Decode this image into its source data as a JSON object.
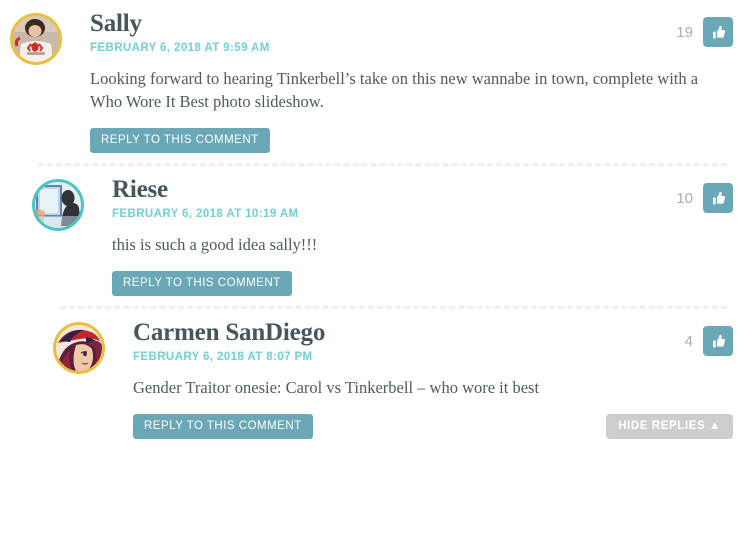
{
  "page": {
    "title": "Comment Thread",
    "accent_teal": "#6aa8b7",
    "date_teal": "#6fcfd6",
    "name_color": "#46565c",
    "body_color": "#4e5b61",
    "gray_button": "#cdcdcd",
    "separator_color": "#eeeff0"
  },
  "comments": [
    {
      "id": "comment-sally",
      "author": "Sally",
      "date": "FEBRUARY 6, 2018 AT 9:59 AM",
      "body": "Looking forward to hearing Tinkerbell’s take on this new wannabe in town, complete with a Who Wore It Best photo slideshow.",
      "vote_count": "19",
      "reply_label": "REPLY TO THIS COMMENT",
      "avatar_ring_color": "#ebbf3b",
      "avatar_alt": "sally-avatar",
      "depth": 0
    },
    {
      "id": "comment-riese",
      "author": "Riese",
      "date": "FEBRUARY 6, 2018 AT 10:19 AM",
      "body": "this is such a good idea sally!!!",
      "vote_count": "10",
      "reply_label": "REPLY TO THIS COMMENT",
      "avatar_ring_color": "#4cc4c4",
      "avatar_alt": "riese-avatar",
      "depth": 1
    },
    {
      "id": "comment-carmen",
      "author": "Carmen SanDiego",
      "date": "FEBRUARY 6, 2018 AT 8:07 PM",
      "body": "Gender Traitor onesie: Carol vs Tinkerbell – who wore it best",
      "vote_count": "4",
      "reply_label": "REPLY TO THIS COMMENT",
      "hide_replies_label": "HIDE REPLIES ▲",
      "avatar_ring_color": "#ebbf3b",
      "avatar_alt": "carmen-sandiego-avatar",
      "depth": 2
    }
  ],
  "icons": {
    "thumbs_up": "thumbs-up-icon",
    "caret_up": "▲"
  }
}
